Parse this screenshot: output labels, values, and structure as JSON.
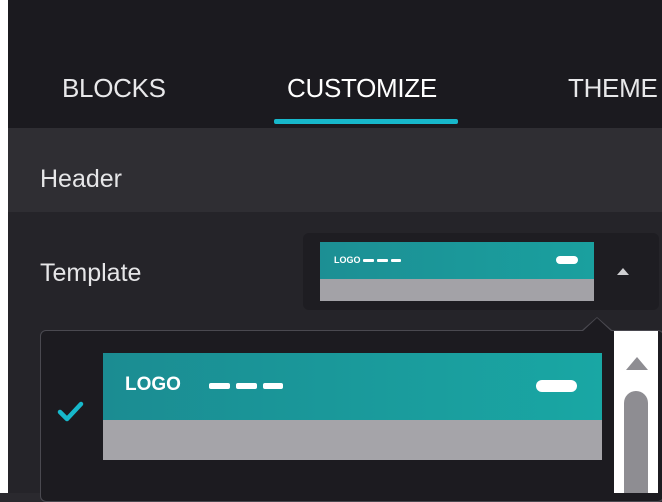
{
  "tabs": [
    {
      "label": "BLOCKS",
      "active": false
    },
    {
      "label": "CUSTOMIZE",
      "active": true
    },
    {
      "label": "THEME",
      "active": false
    }
  ],
  "section": {
    "title": "Header"
  },
  "field": {
    "label": "Template",
    "selected_option": {
      "logo_text": "LOGO"
    },
    "options": [
      {
        "logo_text": "LOGO",
        "selected": true
      }
    ]
  },
  "colors": {
    "accent": "#17b8cb",
    "template_band": "#1a9a9c",
    "template_body": "#a4a3a8"
  },
  "icons": [
    "caret-up-icon",
    "checkmark-icon",
    "scroll-up-arrow-icon"
  ]
}
